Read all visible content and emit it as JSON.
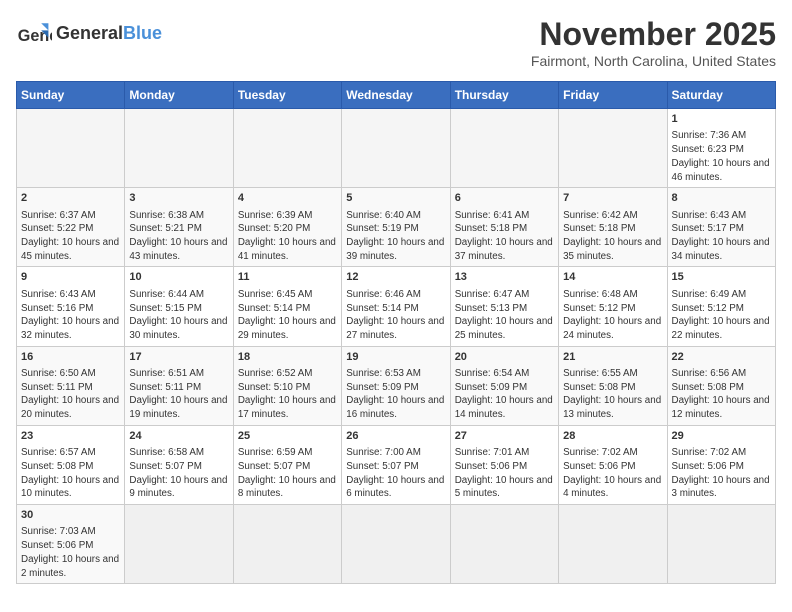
{
  "header": {
    "logo_general": "General",
    "logo_blue": "Blue",
    "title": "November 2025",
    "location": "Fairmont, North Carolina, United States"
  },
  "columns": [
    "Sunday",
    "Monday",
    "Tuesday",
    "Wednesday",
    "Thursday",
    "Friday",
    "Saturday"
  ],
  "weeks": [
    [
      {
        "day": "",
        "info": ""
      },
      {
        "day": "",
        "info": ""
      },
      {
        "day": "",
        "info": ""
      },
      {
        "day": "",
        "info": ""
      },
      {
        "day": "",
        "info": ""
      },
      {
        "day": "",
        "info": ""
      },
      {
        "day": "1",
        "info": "Sunrise: 7:36 AM\nSunset: 6:23 PM\nDaylight: 10 hours and 46 minutes."
      }
    ],
    [
      {
        "day": "2",
        "info": "Sunrise: 6:37 AM\nSunset: 5:22 PM\nDaylight: 10 hours and 45 minutes."
      },
      {
        "day": "3",
        "info": "Sunrise: 6:38 AM\nSunset: 5:21 PM\nDaylight: 10 hours and 43 minutes."
      },
      {
        "day": "4",
        "info": "Sunrise: 6:39 AM\nSunset: 5:20 PM\nDaylight: 10 hours and 41 minutes."
      },
      {
        "day": "5",
        "info": "Sunrise: 6:40 AM\nSunset: 5:19 PM\nDaylight: 10 hours and 39 minutes."
      },
      {
        "day": "6",
        "info": "Sunrise: 6:41 AM\nSunset: 5:18 PM\nDaylight: 10 hours and 37 minutes."
      },
      {
        "day": "7",
        "info": "Sunrise: 6:42 AM\nSunset: 5:18 PM\nDaylight: 10 hours and 35 minutes."
      },
      {
        "day": "8",
        "info": "Sunrise: 6:43 AM\nSunset: 5:17 PM\nDaylight: 10 hours and 34 minutes."
      }
    ],
    [
      {
        "day": "9",
        "info": "Sunrise: 6:43 AM\nSunset: 5:16 PM\nDaylight: 10 hours and 32 minutes."
      },
      {
        "day": "10",
        "info": "Sunrise: 6:44 AM\nSunset: 5:15 PM\nDaylight: 10 hours and 30 minutes."
      },
      {
        "day": "11",
        "info": "Sunrise: 6:45 AM\nSunset: 5:14 PM\nDaylight: 10 hours and 29 minutes."
      },
      {
        "day": "12",
        "info": "Sunrise: 6:46 AM\nSunset: 5:14 PM\nDaylight: 10 hours and 27 minutes."
      },
      {
        "day": "13",
        "info": "Sunrise: 6:47 AM\nSunset: 5:13 PM\nDaylight: 10 hours and 25 minutes."
      },
      {
        "day": "14",
        "info": "Sunrise: 6:48 AM\nSunset: 5:12 PM\nDaylight: 10 hours and 24 minutes."
      },
      {
        "day": "15",
        "info": "Sunrise: 6:49 AM\nSunset: 5:12 PM\nDaylight: 10 hours and 22 minutes."
      }
    ],
    [
      {
        "day": "16",
        "info": "Sunrise: 6:50 AM\nSunset: 5:11 PM\nDaylight: 10 hours and 20 minutes."
      },
      {
        "day": "17",
        "info": "Sunrise: 6:51 AM\nSunset: 5:11 PM\nDaylight: 10 hours and 19 minutes."
      },
      {
        "day": "18",
        "info": "Sunrise: 6:52 AM\nSunset: 5:10 PM\nDaylight: 10 hours and 17 minutes."
      },
      {
        "day": "19",
        "info": "Sunrise: 6:53 AM\nSunset: 5:09 PM\nDaylight: 10 hours and 16 minutes."
      },
      {
        "day": "20",
        "info": "Sunrise: 6:54 AM\nSunset: 5:09 PM\nDaylight: 10 hours and 14 minutes."
      },
      {
        "day": "21",
        "info": "Sunrise: 6:55 AM\nSunset: 5:08 PM\nDaylight: 10 hours and 13 minutes."
      },
      {
        "day": "22",
        "info": "Sunrise: 6:56 AM\nSunset: 5:08 PM\nDaylight: 10 hours and 12 minutes."
      }
    ],
    [
      {
        "day": "23",
        "info": "Sunrise: 6:57 AM\nSunset: 5:08 PM\nDaylight: 10 hours and 10 minutes."
      },
      {
        "day": "24",
        "info": "Sunrise: 6:58 AM\nSunset: 5:07 PM\nDaylight: 10 hours and 9 minutes."
      },
      {
        "day": "25",
        "info": "Sunrise: 6:59 AM\nSunset: 5:07 PM\nDaylight: 10 hours and 8 minutes."
      },
      {
        "day": "26",
        "info": "Sunrise: 7:00 AM\nSunset: 5:07 PM\nDaylight: 10 hours and 6 minutes."
      },
      {
        "day": "27",
        "info": "Sunrise: 7:01 AM\nSunset: 5:06 PM\nDaylight: 10 hours and 5 minutes."
      },
      {
        "day": "28",
        "info": "Sunrise: 7:02 AM\nSunset: 5:06 PM\nDaylight: 10 hours and 4 minutes."
      },
      {
        "day": "29",
        "info": "Sunrise: 7:02 AM\nSunset: 5:06 PM\nDaylight: 10 hours and 3 minutes."
      }
    ],
    [
      {
        "day": "30",
        "info": "Sunrise: 7:03 AM\nSunset: 5:06 PM\nDaylight: 10 hours and 2 minutes."
      },
      {
        "day": "",
        "info": ""
      },
      {
        "day": "",
        "info": ""
      },
      {
        "day": "",
        "info": ""
      },
      {
        "day": "",
        "info": ""
      },
      {
        "day": "",
        "info": ""
      },
      {
        "day": "",
        "info": ""
      }
    ]
  ]
}
